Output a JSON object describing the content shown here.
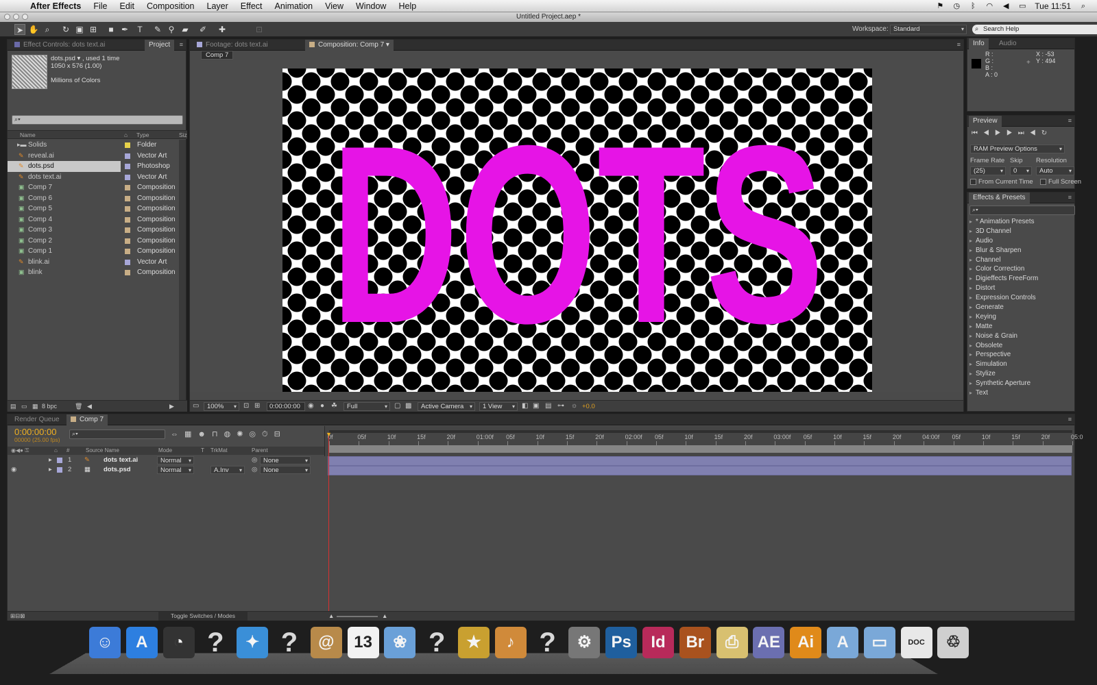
{
  "menubar": {
    "app": "After Effects",
    "items": [
      "File",
      "Edit",
      "Composition",
      "Layer",
      "Effect",
      "Animation",
      "View",
      "Window",
      "Help"
    ],
    "clock": "Tue 11:51"
  },
  "window": {
    "title": "Untitled Project.aep *"
  },
  "workspace": {
    "label": "Workspace:",
    "value": "Standard",
    "search_placeholder": "Search Help"
  },
  "left_tabs": {
    "effect_controls": "Effect Controls: dots text.ai",
    "project": "Project"
  },
  "preview_info": {
    "name": "dots.psd ▾ , used 1 time",
    "size": "1050 x 576 (1.00)",
    "colors": "Millions of Colors"
  },
  "project_columns": {
    "name": "Name",
    "type": "Type",
    "size": "Siz"
  },
  "project_items": [
    {
      "name": "Solids",
      "type": "Folder",
      "label_color": "#e6d14a",
      "icon": "folder-icon"
    },
    {
      "name": "reveal.ai",
      "type": "Vector Art",
      "label_color": "#a7a7d8",
      "icon": "ai-file-icon"
    },
    {
      "name": "dots.psd",
      "type": "Photoshop",
      "label_color": "#a7a7d8",
      "icon": "psd-file-icon"
    },
    {
      "name": "dots text.ai",
      "type": "Vector Art",
      "label_color": "#a7a7d8",
      "icon": "ai-file-icon"
    },
    {
      "name": "Comp 7",
      "type": "Composition",
      "label_color": "#c8ae86",
      "icon": "composition-icon"
    },
    {
      "name": "Comp 6",
      "type": "Composition",
      "label_color": "#c8ae86",
      "icon": "composition-icon"
    },
    {
      "name": "Comp 5",
      "type": "Composition",
      "label_color": "#c8ae86",
      "icon": "composition-icon"
    },
    {
      "name": "Comp 4",
      "type": "Composition",
      "label_color": "#c8ae86",
      "icon": "composition-icon"
    },
    {
      "name": "Comp 3",
      "type": "Composition",
      "label_color": "#c8ae86",
      "icon": "composition-icon"
    },
    {
      "name": "Comp 2",
      "type": "Composition",
      "label_color": "#c8ae86",
      "icon": "composition-icon"
    },
    {
      "name": "Comp 1",
      "type": "Composition",
      "label_color": "#c8ae86",
      "icon": "composition-icon"
    },
    {
      "name": "blink.ai",
      "type": "Vector Art",
      "label_color": "#a7a7d8",
      "icon": "ai-file-icon"
    },
    {
      "name": "blink",
      "type": "Composition",
      "label_color": "#c8ae86",
      "icon": "composition-icon"
    }
  ],
  "project_footer": {
    "bpc": "8 bpc"
  },
  "viewer_tabs": {
    "footage": "Footage: dots text.ai",
    "composition": "Composition: Comp 7 ▾",
    "breadcrumb": "Comp 7"
  },
  "canvas": {
    "text": "DOTS",
    "text_color": "#e614e6",
    "dot_color": "#000000",
    "bg": "#ffffff"
  },
  "viewer_controls": {
    "zoom": "100%",
    "timecode": "0:00:00:00",
    "resolution": "Full",
    "camera": "Active Camera",
    "views": "1 View",
    "exposure": "+0.0"
  },
  "info_panel": {
    "tabs": [
      "Info",
      "Audio"
    ],
    "r": "R :",
    "g": "G :",
    "b": "B :",
    "a": "A : 0",
    "x": "X : -53",
    "y": "Y : 494"
  },
  "preview_panel": {
    "title": "Preview",
    "ram": "RAM Preview Options",
    "frame_rate_label": "Frame Rate",
    "skip_label": "Skip",
    "resolution_label": "Resolution",
    "frame_rate": "(25)",
    "skip": "0",
    "resolution": "Auto",
    "from_current": "From Current Time",
    "full_screen": "Full Screen"
  },
  "effects_panel": {
    "title": "Effects & Presets",
    "items": [
      "* Animation Presets",
      "3D Channel",
      "Audio",
      "Blur & Sharpen",
      "Channel",
      "Color Correction",
      "Digieffects FreeForm",
      "Distort",
      "Expression Controls",
      "Generate",
      "Keying",
      "Matte",
      "Noise & Grain",
      "Obsolete",
      "Perspective",
      "Simulation",
      "Stylize",
      "Synthetic Aperture",
      "Text"
    ]
  },
  "timeline": {
    "tabs": [
      "Render Queue",
      "Comp 7"
    ],
    "timecode": "0:00:00:00",
    "frames": "00000 (25.00 fps)",
    "columns": {
      "num": "#",
      "source": "Source Name",
      "mode": "Mode",
      "t": "T",
      "trkmat": "TrkMat",
      "parent": "Parent"
    },
    "layers": [
      {
        "num": "1",
        "name": "dots text.ai",
        "mode": "Normal",
        "trkmat": "",
        "parent": "None"
      },
      {
        "num": "2",
        "name": "dots.psd",
        "mode": "Normal",
        "trkmat": "A.Inv",
        "parent": "None"
      }
    ],
    "ruler": [
      "0f",
      "05f",
      "10f",
      "15f",
      "20f",
      "01:00f",
      "05f",
      "10f",
      "15f",
      "20f",
      "02:00f",
      "05f",
      "10f",
      "15f",
      "20f",
      "03:00f",
      "05f",
      "10f",
      "15f",
      "20f",
      "04:00f",
      "05f",
      "10f",
      "15f",
      "20f",
      "05:0"
    ],
    "toggle": "Toggle Switches / Modes"
  },
  "dock": [
    {
      "name": "finder",
      "glyph": "☺",
      "color": "#3c7bd8"
    },
    {
      "name": "app-store",
      "glyph": "A",
      "color": "#2d7fe0"
    },
    {
      "name": "dashboard",
      "glyph": "◔",
      "color": "#333333"
    },
    {
      "name": "missing-app-1",
      "glyph": "?",
      "color": "#bbbbbb"
    },
    {
      "name": "safari",
      "glyph": "✦",
      "color": "#3a8fd8"
    },
    {
      "name": "missing-app-2",
      "glyph": "?",
      "color": "#bbbbbb"
    },
    {
      "name": "address-book",
      "glyph": "@",
      "color": "#b88a4a"
    },
    {
      "name": "ical",
      "glyph": "13",
      "color": "#f2f2f2"
    },
    {
      "name": "iphoto",
      "glyph": "❀",
      "color": "#6aa0d8"
    },
    {
      "name": "missing-app-3",
      "glyph": "?",
      "color": "#bbbbbb"
    },
    {
      "name": "imovie",
      "glyph": "★",
      "color": "#c9a030"
    },
    {
      "name": "garageband",
      "glyph": "♪",
      "color": "#d08a3a"
    },
    {
      "name": "missing-app-4",
      "glyph": "?",
      "color": "#bbbbbb"
    },
    {
      "name": "system-preferences",
      "glyph": "⚙",
      "color": "#777777"
    },
    {
      "name": "photoshop",
      "glyph": "Ps",
      "color": "#1f5f9e"
    },
    {
      "name": "indesign",
      "glyph": "Id",
      "color": "#b82a5a"
    },
    {
      "name": "bridge",
      "glyph": "Br",
      "color": "#a9521e"
    },
    {
      "name": "printer",
      "glyph": "⎙",
      "color": "#d8c070"
    },
    {
      "name": "after-effects",
      "glyph": "AE",
      "color": "#6b6fb0"
    },
    {
      "name": "illustrator",
      "glyph": "Ai",
      "color": "#e08a1a"
    },
    {
      "name": "applications-folder",
      "glyph": "A",
      "color": "#7aa8d8"
    },
    {
      "name": "documents-folder",
      "glyph": "▭",
      "color": "#7aa8d8"
    },
    {
      "name": "doc-stack",
      "glyph": "DOC",
      "color": "#e8e8e8"
    },
    {
      "name": "trash",
      "glyph": "♲",
      "color": "#cfcfcf"
    }
  ]
}
